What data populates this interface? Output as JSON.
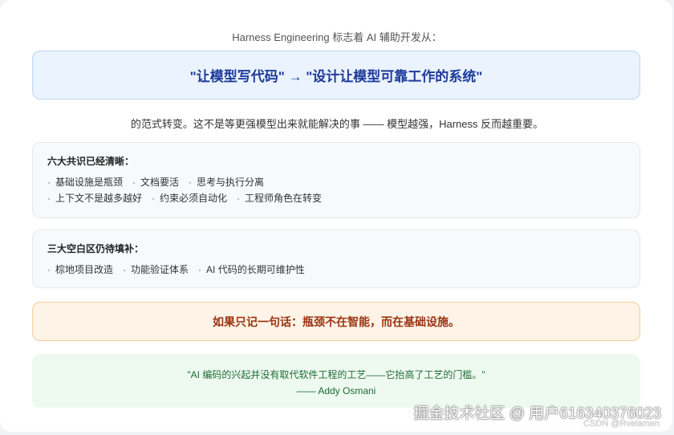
{
  "intro": "Harness Engineering 标志着 AI 辅助开发从：",
  "highlight": "\"让模型写代码\" → \"设计让模型可靠工作的系统\"",
  "paragraph": "的范式转变。这不是等更强模型出来就能解决的事 —— 模型越强，Harness 反而越重要。",
  "consensus": {
    "title": "六大共识已经清晰：",
    "row1": [
      "基础设施是瓶颈",
      "文档要活",
      "思考与执行分离"
    ],
    "row2": [
      "上下文不是越多越好",
      "约束必须自动化",
      "工程师角色在转变"
    ]
  },
  "gaps": {
    "title": "三大空白区仍待填补：",
    "items": [
      "棕地项目改造",
      "功能验证体系",
      "AI 代码的长期可维护性"
    ]
  },
  "takeaway": "如果只记一句话：瓶颈不在智能，而在基础设施。",
  "quote": {
    "text": "\"AI 编码的兴起并没有取代软件工程的工艺——它抬高了工艺的门槛。\"",
    "author": "—— Addy Osmani"
  },
  "watermark": "掘金技术社区 @ 用户616340376023",
  "watermark2": "CSDN @Rvelamen"
}
